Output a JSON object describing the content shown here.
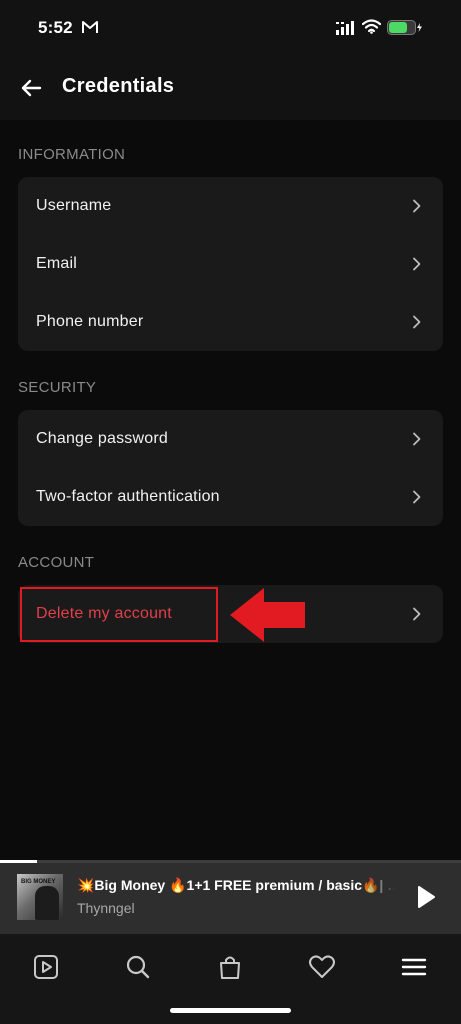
{
  "status_bar": {
    "time": "5:52",
    "icons": [
      "gmail-icon",
      "signal-icon",
      "wifi-icon",
      "battery-icon"
    ]
  },
  "header": {
    "title": "Credentials",
    "back_icon": "arrow-left-icon"
  },
  "sections": {
    "information": {
      "label": "INFORMATION",
      "items": [
        "Username",
        "Email",
        "Phone number"
      ]
    },
    "security": {
      "label": "SECURITY",
      "items": [
        "Change password",
        "Two-factor authentication"
      ]
    },
    "account": {
      "label": "ACCOUNT",
      "items": [
        "Delete my account"
      ]
    }
  },
  "annotation": {
    "highlight_color": "#e21b23",
    "pointer": "red-arrow-icon"
  },
  "mini_player": {
    "title": "💥Big Money 🔥1+1 FREE premium / basic🔥| …",
    "artist": "Thynngel",
    "album_art_text": "BIG MONEY",
    "progress": 0.08,
    "play_icon": "play-icon"
  },
  "bottom_nav": {
    "items": [
      "video-icon",
      "search-icon",
      "shopping-bag-icon",
      "heart-icon",
      "menu-icon"
    ]
  },
  "colors": {
    "background": "#0b0b0b",
    "card": "#1a1a1a",
    "danger_text": "#e0404a",
    "section_label": "#8a8a8a"
  }
}
